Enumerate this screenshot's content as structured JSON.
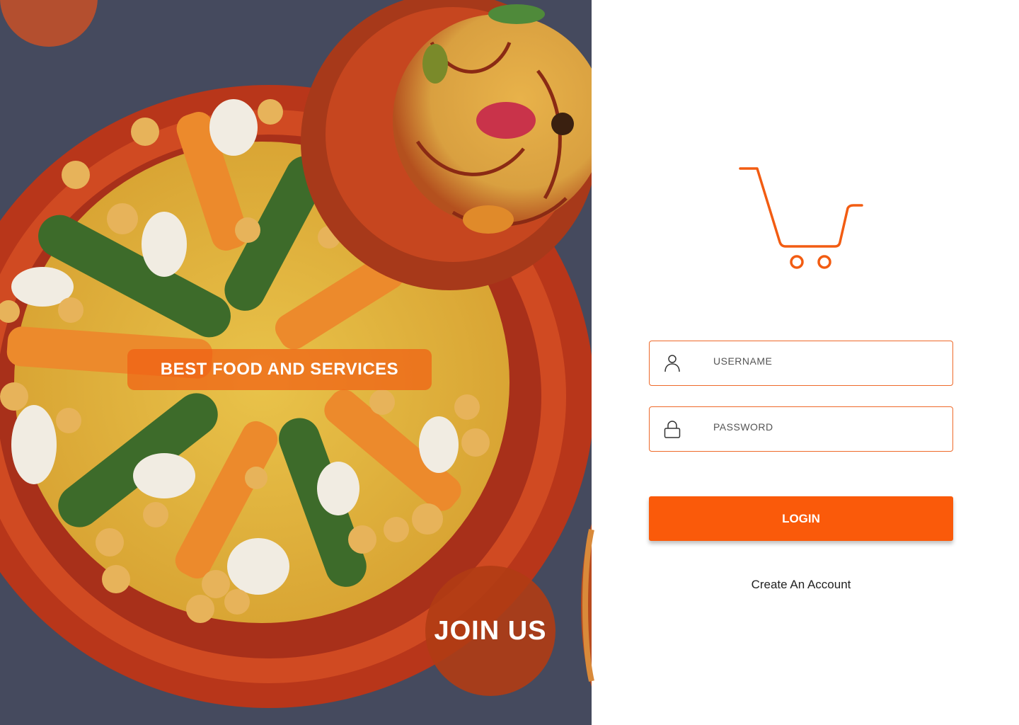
{
  "hero": {
    "tagline": "BEST FOOD AND SERVICES",
    "join_label": "JOIN US"
  },
  "form": {
    "username": {
      "placeholder": "USERNAME",
      "value": "",
      "icon": "user-icon"
    },
    "password": {
      "placeholder": "PASSWORD",
      "value": "",
      "icon": "lock-icon"
    },
    "login_label": "LOGIN",
    "create_account_label": "Create An Account"
  },
  "icons": {
    "logo": "shopping-cart-icon"
  },
  "colors": {
    "accent": "#fa5a0a",
    "field_border": "#ee6a2a",
    "hero_pill": "#f06014",
    "join_circle": "#b03c14"
  }
}
